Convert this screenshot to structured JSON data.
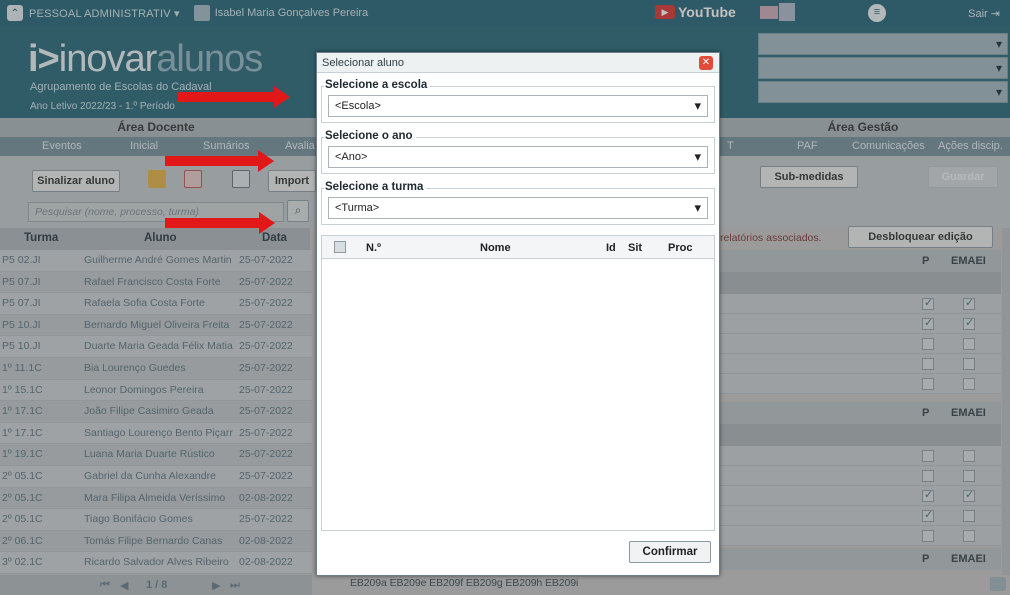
{
  "topbar": {
    "profile": "PESSOAL ADMINISTRATIV ▾",
    "user_name": "Isabel Maria Gonçalves Pereira",
    "youtube": "YouTube",
    "logout": "Sair"
  },
  "header": {
    "logo_prefix": "inovar",
    "logo_suffix": "alunos",
    "school": "Agrupamento de Escolas do Cadaval",
    "year": "Ano Letivo 2022/23 - 1.º Período"
  },
  "areas": {
    "left": "Área Docente",
    "right": "Área Gestão"
  },
  "menu": {
    "left": [
      "Eventos",
      "Inicial",
      "Sumários",
      "Avalia"
    ],
    "right": [
      "T",
      "PAF",
      "Comunicações",
      "Ações discip."
    ]
  },
  "toolbar": {
    "sinalizar": "Sinalizar aluno",
    "importar": "Import",
    "submedidas": "Sub-medidas",
    "guardar": "Guardar",
    "search_placeholder": "Pesquisar (nome, processo, turma)"
  },
  "table": {
    "headers": [
      "Turma",
      "Aluno",
      "Data"
    ],
    "rows": [
      [
        "P5 02.JI",
        "Guilherme André Gomes Martin",
        "25-07-2022"
      ],
      [
        "P5 07.JI",
        "Rafael Francisco Costa Forte",
        "25-07-2022"
      ],
      [
        "P5 07.JI",
        "Rafaela Sofia Costa Forte",
        "25-07-2022"
      ],
      [
        "P5 10.JI",
        "Bernardo Miguel Oliveira Freita",
        "25-07-2022"
      ],
      [
        "P5 10.JI",
        "Duarte Maria Geada Félix Matia",
        "25-07-2022"
      ],
      [
        "1º 11.1C",
        "Bia Lourenço Guedes",
        "25-07-2022"
      ],
      [
        "1º 15.1C",
        "Leonor Domingos Pereira",
        "25-07-2022"
      ],
      [
        "1º 17.1C",
        "João Filipe Casimiro Geada",
        "25-07-2022"
      ],
      [
        "1º 17.1C",
        "Santiago Lourenço Bento Piçarr",
        "25-07-2022"
      ],
      [
        "1º 19.1C",
        "Luana Maria Duarte Rústico",
        "25-07-2022"
      ],
      [
        "2º 05.1C",
        "Gabriel da Cunha Alexandre",
        "25-07-2022"
      ],
      [
        "2º 05.1C",
        "Mara Filipa Almeida Veríssimo",
        "02-08-2022"
      ],
      [
        "2º 05.1C",
        "Tiago Bonifácio Gomes",
        "25-07-2022"
      ],
      [
        "2º 06.1C",
        "Tomás Filipe Bernardo Canas",
        "02-08-2022"
      ],
      [
        "3º 02.1C",
        "Ricardo Salvador Alves Ribeiro",
        "02-08-2022"
      ]
    ]
  },
  "pager": {
    "text": "1 / 8"
  },
  "right": {
    "message": "relatórios associados.",
    "unlock": "Desbloquear edição",
    "col_p": "P",
    "col_emaei": "EMAEI"
  },
  "codes": "EB209a EB209e EB209f EB209g EB209h EB209i",
  "dialog": {
    "title": "Selecionar aluno",
    "school_label": "Selecione a escola",
    "school_value": "<Escola>",
    "year_label": "Selecione o ano",
    "year_value": "<Ano>",
    "class_label": "Selecione a turma",
    "class_value": "<Turma>",
    "grid_headers": [
      "N.º",
      "Nome",
      "Id",
      "Sit",
      "Proc"
    ],
    "confirm": "Confirmar"
  },
  "colors": {
    "header": "#1f6376",
    "annotation_arrow": "#e21818"
  }
}
